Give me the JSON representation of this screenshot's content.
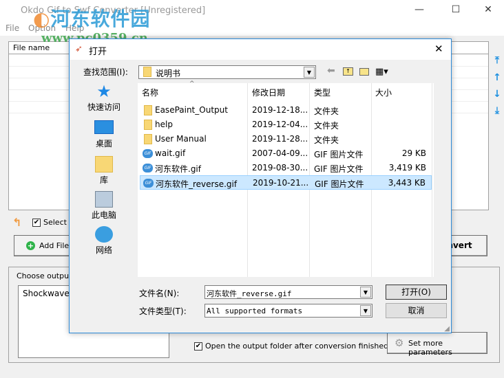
{
  "window": {
    "title": "Okdo Gif to Swf Converter [Unregistered]",
    "minimize": "—",
    "maximize": "☐",
    "close": "✕"
  },
  "menu": [
    "File",
    "Option",
    "Help"
  ],
  "file_list": {
    "header": "File name"
  },
  "select_all": {
    "label": "Select All",
    "checked": true
  },
  "add_files_label": "Add Files",
  "convert_label": "Convert",
  "output": {
    "label": "Choose output format",
    "formats": [
      "Shockwave"
    ]
  },
  "open_folder": {
    "label": "Open the output folder after conversion finished",
    "checked": true
  },
  "set_params_label": "Set more parameters",
  "watermark": {
    "name": "河东软件园",
    "url": "www.pc0359.cn"
  },
  "dialog": {
    "title": "打开",
    "look_in_label": "查找范围(I):",
    "look_in_value": "说明书",
    "places": [
      "快速访问",
      "桌面",
      "库",
      "此电脑",
      "网络"
    ],
    "columns": [
      "名称",
      "修改日期",
      "类型",
      "大小"
    ],
    "files": [
      {
        "name": "EasePaint_Output",
        "date": "2019-12-18...",
        "type": "文件夹",
        "size": "",
        "icon": "folder"
      },
      {
        "name": "help",
        "date": "2019-12-04...",
        "type": "文件夹",
        "size": "",
        "icon": "folder"
      },
      {
        "name": "User Manual",
        "date": "2019-11-28...",
        "type": "文件夹",
        "size": "",
        "icon": "folder"
      },
      {
        "name": "wait.gif",
        "date": "2007-04-09...",
        "type": "GIF 图片文件",
        "size": "29 KB",
        "icon": "gif"
      },
      {
        "name": "河东软件.gif",
        "date": "2019-08-30...",
        "type": "GIF 图片文件",
        "size": "3,419 KB",
        "icon": "gif"
      },
      {
        "name": "河东软件_reverse.gif",
        "date": "2019-10-21...",
        "type": "GIF 图片文件",
        "size": "3,443 KB",
        "icon": "gif",
        "selected": true
      }
    ],
    "filename_label": "文件名(N):",
    "filename_value": "河东软件_reverse.gif",
    "filetype_label": "文件类型(T):",
    "filetype_value": "All supported formats",
    "open_label": "打开(O)",
    "cancel_label": "取消",
    "close": "✕"
  }
}
